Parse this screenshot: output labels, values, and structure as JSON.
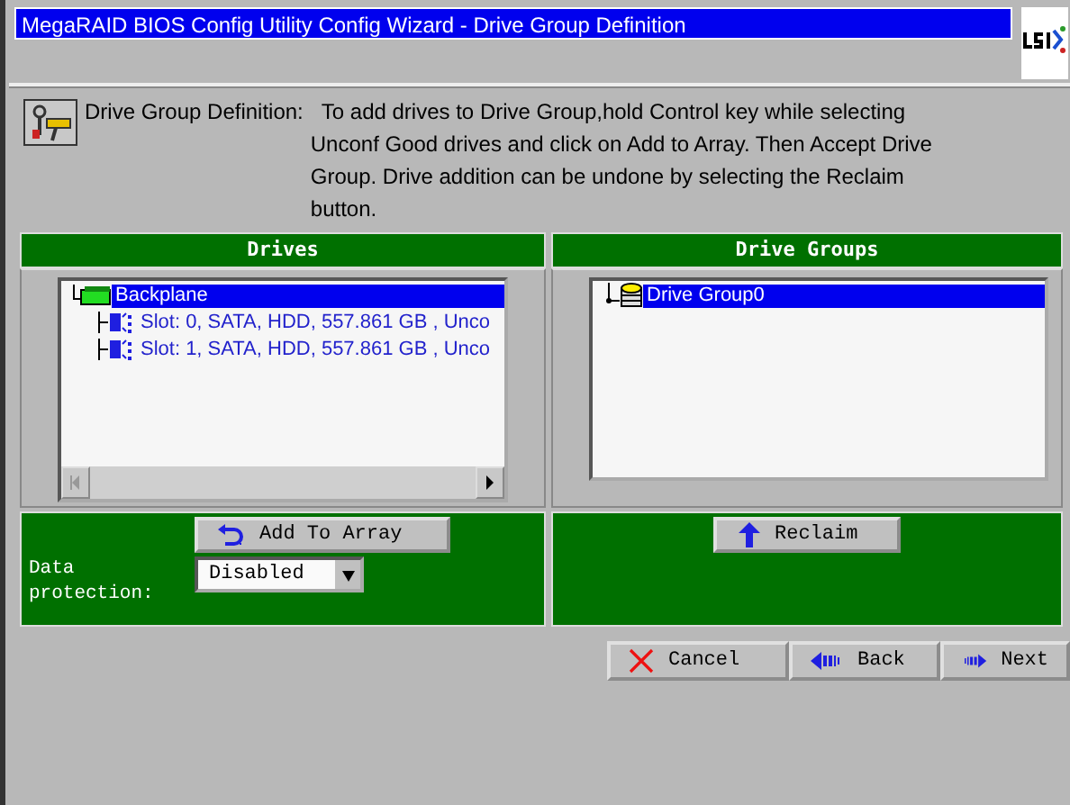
{
  "window": {
    "title": "MegaRAID BIOS Config Utility  Config Wizard - Drive Group Definition"
  },
  "description": {
    "heading": "Drive Group Definition:",
    "lines": [
      "To add drives to Drive Group,hold Control key while selecting",
      "Unconf Good drives and click on Add to Array. Then Accept Drive",
      "Group. Drive addition can be undone by selecting the Reclaim",
      "button."
    ]
  },
  "drives": {
    "title": "Drives",
    "tree": [
      {
        "label": "Backplane",
        "kind": "backplane",
        "selected": true,
        "children": [
          {
            "label": "Slot: 0, SATA, HDD, 557.861 GB , Unco",
            "kind": "drive",
            "selected": false
          },
          {
            "label": "Slot: 1, SATA, HDD, 557.861 GB , Unco",
            "kind": "drive",
            "selected": false
          }
        ]
      }
    ],
    "add_button": {
      "label": "Add To Array"
    },
    "data_protection": {
      "label": "Data protection:",
      "value": "Disabled"
    }
  },
  "drive_groups": {
    "title": "Drive Groups",
    "tree": [
      {
        "label": "Drive Group0",
        "kind": "group",
        "selected": true
      }
    ],
    "reclaim_button": {
      "label": "Reclaim"
    }
  },
  "buttons": [
    {
      "label": "Cancel",
      "kind": "cancel"
    },
    {
      "label": "Back",
      "kind": "back"
    },
    {
      "label": "Next",
      "kind": "next"
    }
  ]
}
